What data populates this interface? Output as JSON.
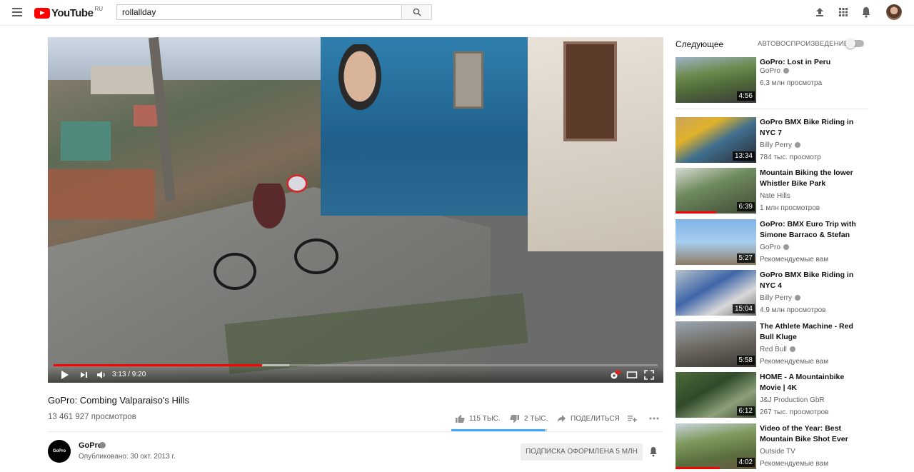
{
  "header": {
    "logo_text": "YouTube",
    "region": "RU",
    "search_value": "rollallday"
  },
  "player": {
    "time_display": "3:13 / 9:20",
    "progress_played": 0.345,
    "progress_buffered": 0.39
  },
  "video": {
    "title": "GoPro: Combing Valparaiso's Hills",
    "views": "13 461 927 просмотров",
    "likes": "115 ТЫС.",
    "dislikes": "2 ТЫС.",
    "share": "ПОДЕЛИТЬСЯ",
    "like_ratio": 0.98
  },
  "owner": {
    "avatar_text": "GoPro",
    "name": "GoPro",
    "published": "Опубликовано: 30 окт. 2013 г.",
    "subscribe_label": "ПОДПИСКА ОФОРМЛЕНА  5 МЛН"
  },
  "sidebar": {
    "up_next": "Следующее",
    "autoplay": "АВТОВОСПРОИЗВЕДЕНИЕ",
    "items": [
      {
        "title": "GoPro: Lost in Peru",
        "channel": "GoPro",
        "verified": true,
        "meta": "6,3 млн просмотра",
        "duration": "4:56",
        "watched": 0,
        "thumb": "linear-gradient(170deg,#9fb3c7 0%,#6d8a4e 35%,#4f6b3a 60%,#3b3b3b 100%)"
      },
      {
        "title": "GoPro BMX Bike Riding in NYC 7",
        "channel": "Billy Perry",
        "verified": true,
        "meta": "784 тыс. просмотр",
        "duration": "13:34",
        "watched": 0,
        "thumb": "linear-gradient(150deg,#c9a45a 0%,#e0b22c 30%,#3f6f8f 55%,#2a2a30 100%)"
      },
      {
        "title": "Mountain Biking the lower Whistler Bike Park",
        "channel": "Nate Hills",
        "verified": false,
        "meta": "1 млн просмотров",
        "duration": "6:39",
        "watched": 0.5,
        "thumb": "linear-gradient(160deg,#d8dcd4 0%,#6f8a5e 40%,#3e4a36 100%)"
      },
      {
        "title": "GoPro: BMX Euro Trip with Simone Barraco & Stefan",
        "channel": "GoPro",
        "verified": true,
        "meta": "Рекомендуемые вам",
        "duration": "5:27",
        "watched": 0,
        "thumb": "linear-gradient(180deg,#7fb4e6 0%,#a8cdf0 50%,#8c7a64 100%)"
      },
      {
        "title": "GoPro BMX Bike Riding in NYC 4",
        "channel": "Billy Perry",
        "verified": true,
        "meta": "4,9 млн просмотров",
        "duration": "15:04",
        "watched": 0,
        "thumb": "linear-gradient(150deg,#b7c2cc 0%,#3f66a8 40%,#d9d9d9 70%,#6a6a6a 100%)"
      },
      {
        "title": "The Athlete Machine - Red Bull Kluge",
        "channel": "Red Bull",
        "verified": true,
        "meta": "Рекомендуемые вам",
        "duration": "5:58",
        "watched": 0,
        "thumb": "linear-gradient(170deg,#9aa6b2 0%,#6e6a62 50%,#3a3632 100%)"
      },
      {
        "title": "HOME - A Mountainbike Movie | 4K",
        "channel": "J&J Production GbR",
        "verified": false,
        "meta": "267 тыс. просмотров",
        "duration": "6:12",
        "watched": 0,
        "thumb": "linear-gradient(150deg,#4d6a3a 0%,#2f4a2a 40%,#8ca07a 70%,#3a4a30 100%)"
      },
      {
        "title": "Video of the Year: Best Mountain Bike Shot Ever",
        "channel": "Outside TV",
        "verified": false,
        "meta": "Рекомендуемые вам",
        "duration": "4:02",
        "watched": 0.55,
        "thumb": "linear-gradient(170deg,#c8d4de 0%,#7f9a5e 35%,#5a6e3e 70%,#6a5a40 100%)"
      }
    ]
  }
}
